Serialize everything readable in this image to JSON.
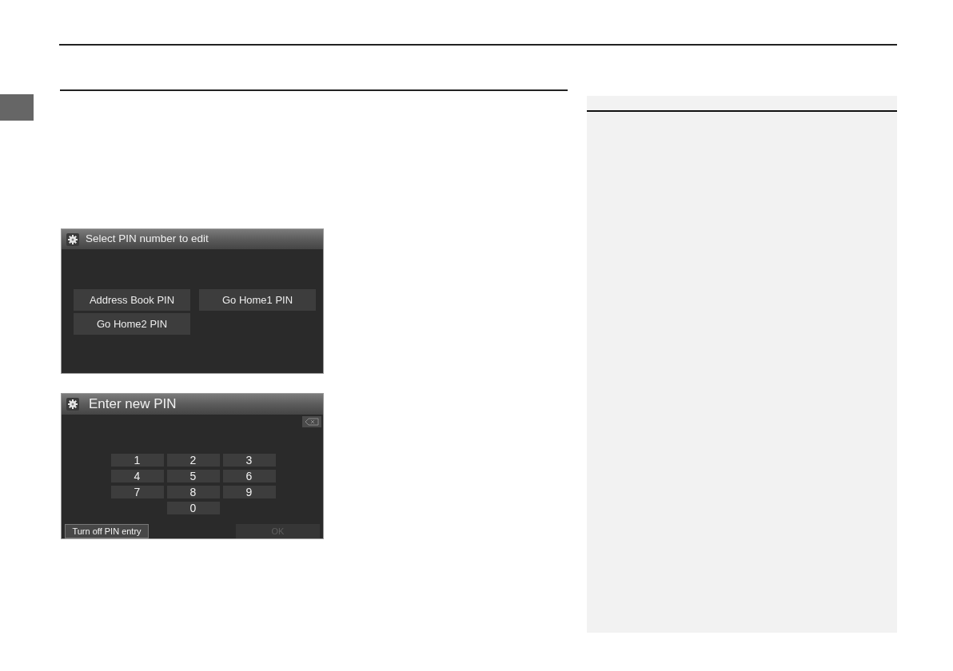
{
  "pin_select_screen": {
    "title": "Select PIN number to edit",
    "options": [
      {
        "label": "Address Book PIN"
      },
      {
        "label": "Go Home1 PIN"
      },
      {
        "label": "Go Home2 PIN"
      }
    ]
  },
  "pin_entry_screen": {
    "title": "Enter new PIN",
    "keys": [
      "1",
      "2",
      "3",
      "4",
      "5",
      "6",
      "7",
      "8",
      "9",
      "0"
    ],
    "footer_buttons": [
      {
        "label": "Turn off PIN entry",
        "disabled": false
      },
      {
        "label": "OK",
        "disabled": true
      }
    ]
  }
}
